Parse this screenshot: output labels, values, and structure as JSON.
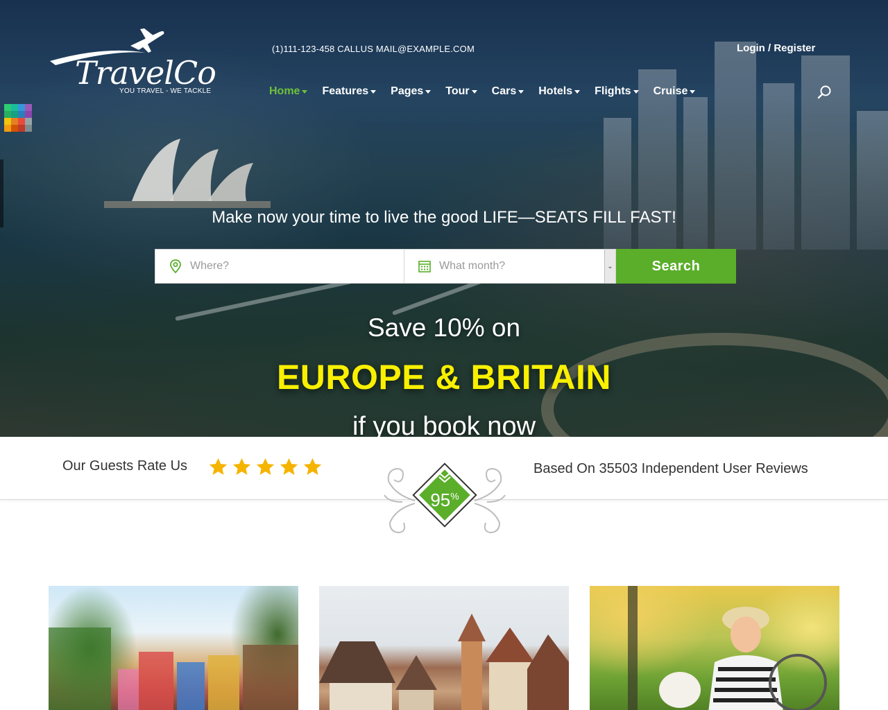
{
  "brand": {
    "name": "TravelCo",
    "tagline": "YOU TRAVEL - WE TACKLE"
  },
  "topbar": {
    "contact": "(1)111-123-458 CALLUS MAIL@EXAMPLE.COM",
    "login": "Login",
    "separator": "/",
    "register": "Register"
  },
  "nav": {
    "items": [
      {
        "label": "Home",
        "active": true
      },
      {
        "label": "Features"
      },
      {
        "label": "Pages"
      },
      {
        "label": "Tour"
      },
      {
        "label": "Cars"
      },
      {
        "label": "Hotels"
      },
      {
        "label": "Flights"
      },
      {
        "label": "Cruise"
      }
    ],
    "search_icon": "search-icon"
  },
  "hero": {
    "tagline": "Make now your time to live the good LIFE—SEATS FILL FAST!",
    "search": {
      "where_placeholder": "Where?",
      "month_placeholder": "What month?",
      "button": "Search"
    },
    "save_line": "Save 10% on",
    "promo_line": "EUROPE & BRITAIN",
    "book_line": "if you book now"
  },
  "rating": {
    "label": "Our Guests Rate Us",
    "stars": 5,
    "badge_value": "95",
    "badge_unit": "%",
    "reviews_text": "Based On 35503 Independent User Reviews"
  },
  "colors": {
    "accent_green": "#5aae2a",
    "nav_active": "#6fc13b",
    "promo_yellow": "#f8f000",
    "star_gold": "#f5b400"
  }
}
